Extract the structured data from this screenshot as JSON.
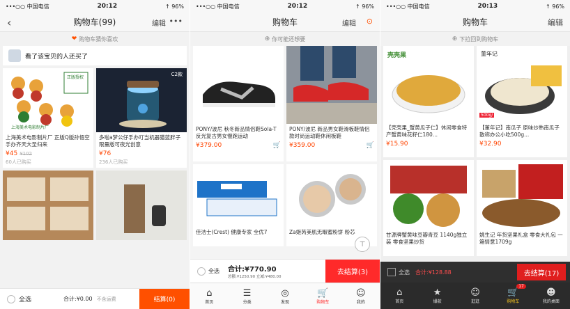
{
  "screen1": {
    "status": {
      "carrier": "•••○○ 中国电信",
      "time": "20:12",
      "battery": "↑ 96%"
    },
    "nav": {
      "title": "购物车(99)",
      "back": "‹",
      "edit": "编辑",
      "more": "•••"
    },
    "banner": "购物车猜你喜欢",
    "section": "看了该宝贝的人还买了",
    "products": [
      {
        "name": "上海美术电影制片厂 正版Q版孙悟空手办齐天大圣归来",
        "price": "¥45",
        "old": "¥102",
        "sold": "60人已购买",
        "caption": "上海美术电影制片厂",
        "corner": "正版授权"
      },
      {
        "name": "多啦a梦公仔手办叮当机器猫蓝胖子限量版可夜光创意",
        "price": "¥76",
        "sold": "236人已购买",
        "caption": "C2款"
      }
    ],
    "bottom": {
      "select_all": "全选",
      "total": "合计:¥0.00",
      "shipping": "不含运费",
      "checkout": "结算(0)"
    }
  },
  "screen2": {
    "status": {
      "carrier": "•••○○ 中国电信",
      "time": "20:12",
      "battery": "↑ 96%"
    },
    "nav": {
      "title": "购物车",
      "edit": "编辑",
      "msg": "⊙"
    },
    "banner": "你可能还想要",
    "products": [
      {
        "name": "PONY/波尼 秋冬新品情侣鞋Sola-T反光复古男女慢跑运动",
        "price": "¥379.00"
      },
      {
        "name": "PONY/波尼 新品男女鞋滑板鞋情侣款时尚运动鞋休闲板鞋",
        "price": "¥359.00"
      },
      {
        "name": "佳洁士(Crest) 健康专家 全优7",
        "price": ""
      },
      {
        "name": "Za姬芮美肌无暇蜜粉饼 粉芯",
        "price": ""
      }
    ],
    "bottom": {
      "select_all": "全选",
      "total": "合计:¥770.90",
      "sub": "总额:¥1250.90 立减:¥480.00",
      "checkout": "去结算(3)"
    },
    "tabs": [
      {
        "label": "首页",
        "icon": "⌂"
      },
      {
        "label": "分类",
        "icon": "☰"
      },
      {
        "label": "发现",
        "icon": "◎"
      },
      {
        "label": "购物车",
        "icon": "🛒"
      },
      {
        "label": "我的",
        "icon": "☺"
      }
    ]
  },
  "screen3": {
    "status": {
      "carrier": "•••○○ 中国电信",
      "time": "20:13",
      "battery": "↑ 96%"
    },
    "nav": {
      "title": "购物车",
      "edit": "编辑"
    },
    "banner": "下拉回到购物车",
    "products": [
      {
        "name": "【壳壳果_蟹黄瓜子仁】休闲零食特产蟹黄味花籽仁180...",
        "price": "¥15.90",
        "brand": "壳壳果"
      },
      {
        "name": "【董年记】南瓜子 原味炒熟南瓜子 散称办公小吃500g...",
        "price": "¥32.90",
        "brand": "董年记",
        "tag": "500g/"
      },
      {
        "name": "甘源牌蟹黄味豆瓣青豆 1140g独立装 零食坚果炒货",
        "price": ""
      },
      {
        "name": "姚生记 年货坚果礼盒 零食大礼包 一箱情意1709g",
        "price": ""
      }
    ],
    "bottom": {
      "select_all": "全选",
      "total": "合计:¥128.88",
      "checkout": "去结算(17)"
    },
    "tabs": [
      {
        "label": "首页",
        "icon": "⌂"
      },
      {
        "label": "爆款",
        "icon": "★"
      },
      {
        "label": "逛逛",
        "icon": "☺"
      },
      {
        "label": "购物车",
        "icon": "🛒",
        "badge": "17"
      },
      {
        "label": "我的桌面",
        "icon": "☻"
      }
    ]
  },
  "colors": {
    "accent": "#ff5000",
    "cart_red": "#ff2a2a",
    "price": "#ff4400",
    "dark_tab": "#2f2f2f"
  }
}
